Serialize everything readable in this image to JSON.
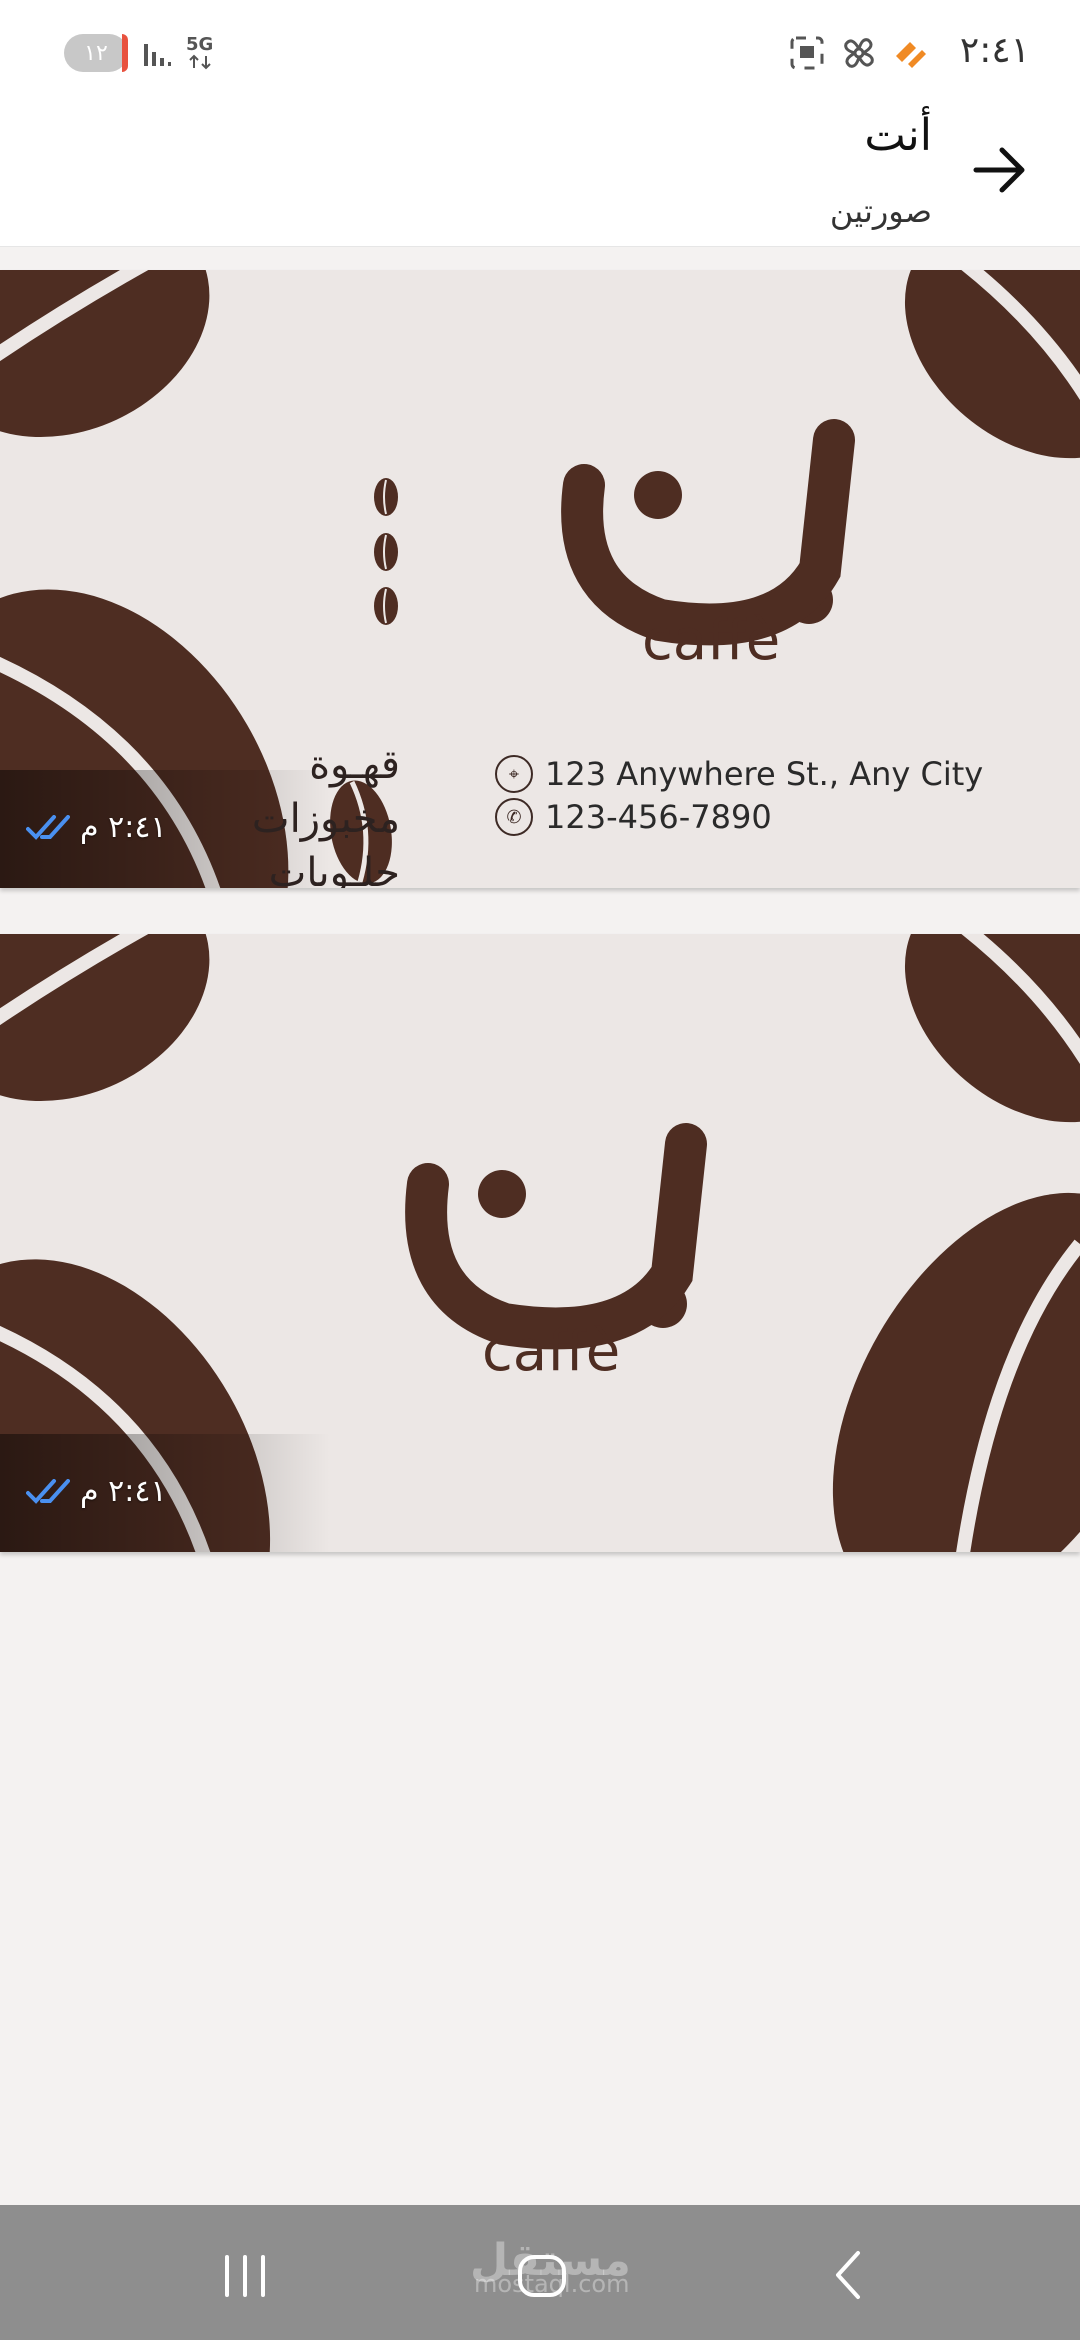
{
  "status_bar": {
    "time": "٢:٤١",
    "battery": "١٢",
    "network": "5G"
  },
  "header": {
    "title": "أنت",
    "subtitle": "صورتين",
    "back_icon": "arrow-right-icon"
  },
  "images": [
    {
      "brand_arabic": "بن",
      "brand_latin": "caffè",
      "menu": [
        "قهـوة",
        "مخبوزات",
        "حلـويات"
      ],
      "address": "123 Anywhere St., Any City",
      "phone": "123-456-7890",
      "timestamp": "٢:٤١ م"
    },
    {
      "brand_arabic": "بن",
      "brand_latin": "caffè",
      "timestamp": "٢:٤١ م"
    }
  ],
  "nav": {
    "recents_icon": "recents-icon",
    "home_icon": "home-icon",
    "back_icon": "chevron-left-icon"
  },
  "watermark": {
    "text": "مستقل",
    "sub": "mostaql.com"
  },
  "colors": {
    "coffee_brown": "#4e2d22",
    "card_bg": "#ece7e5",
    "tick_blue": "#4a90f0",
    "nav_bg": "#8e8e8e"
  }
}
